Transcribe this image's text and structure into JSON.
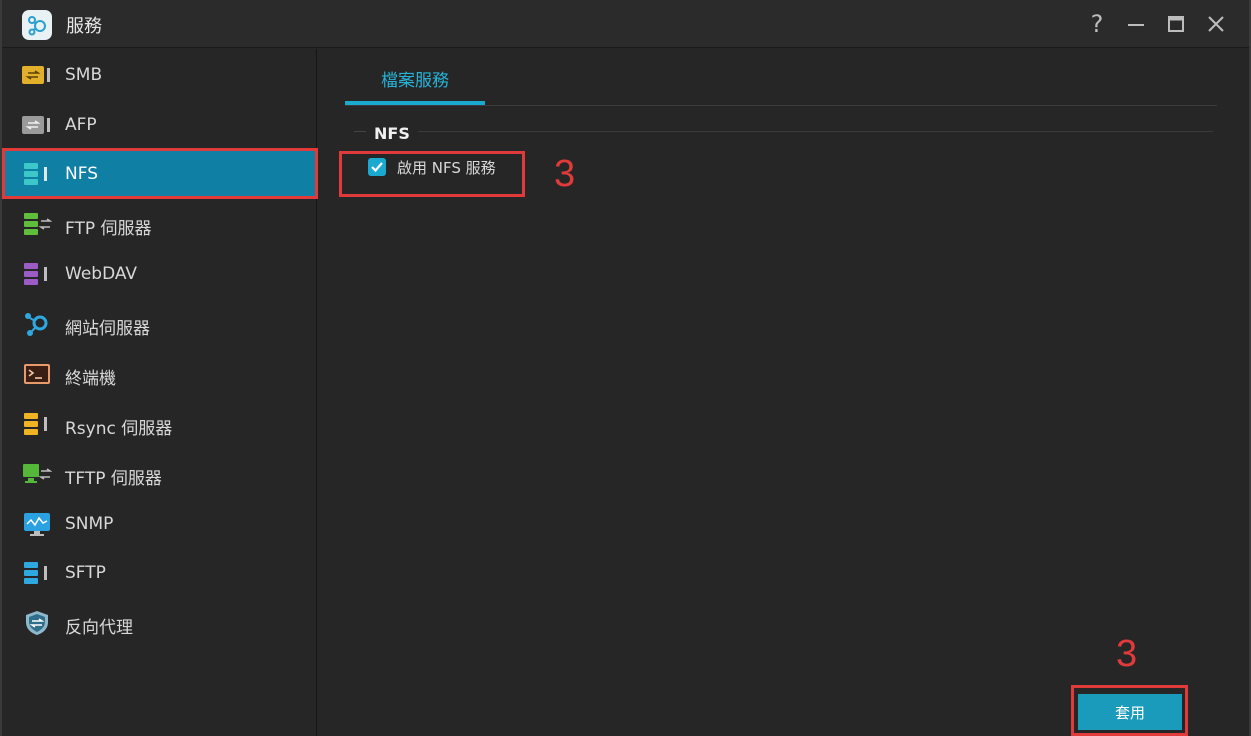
{
  "window": {
    "title": "服務",
    "app_icon": "network-services-icon",
    "controls": {
      "help": "?",
      "minimize": "—",
      "maximize": "☐",
      "close": "✕"
    }
  },
  "sidebar": {
    "items": [
      {
        "label": "SMB",
        "icon": "smb-server-icon",
        "color": "#e3b02c",
        "active": false
      },
      {
        "label": "AFP",
        "icon": "afp-server-icon",
        "color": "#9a9a9a",
        "active": false
      },
      {
        "label": "NFS",
        "icon": "nfs-server-icon",
        "color": "#3cc8c8",
        "active": true
      },
      {
        "label": "FTP 伺服器",
        "icon": "ftp-server-icon",
        "color": "#5fbf3c",
        "active": false
      },
      {
        "label": "WebDAV",
        "icon": "webdav-server-icon",
        "color": "#9b5cc6",
        "active": false
      },
      {
        "label": "網站伺服器",
        "icon": "web-server-icon",
        "color": "#2ea8e0",
        "active": false
      },
      {
        "label": "終端機",
        "icon": "terminal-icon",
        "color": "#e89a6a",
        "active": false
      },
      {
        "label": "Rsync 伺服器",
        "icon": "rsync-server-icon",
        "color": "#f0b323",
        "active": false
      },
      {
        "label": "TFTP 伺服器",
        "icon": "tftp-server-icon",
        "color": "#55b83a",
        "active": false
      },
      {
        "label": "SNMP",
        "icon": "snmp-monitor-icon",
        "color": "#2aa1e0",
        "active": false
      },
      {
        "label": "SFTP",
        "icon": "sftp-server-icon",
        "color": "#2ea8e0",
        "active": false
      },
      {
        "label": "反向代理",
        "icon": "reverse-proxy-shield-icon",
        "color": "#8fb8cc",
        "active": false
      }
    ]
  },
  "main": {
    "tabs": [
      {
        "label": "檔案服務",
        "active": true
      }
    ],
    "section_title": "NFS",
    "enable_nfs": {
      "label": "啟用 NFS 服務",
      "checked": true
    },
    "apply_label": "套用"
  },
  "annotations": {
    "step_marker_1": "3",
    "step_marker_2": "3",
    "highlight_color": "#e03a3a"
  },
  "colors": {
    "accent": "#1aa9cf",
    "active_sidebar": "#0f7fa4",
    "background": "#262626"
  }
}
